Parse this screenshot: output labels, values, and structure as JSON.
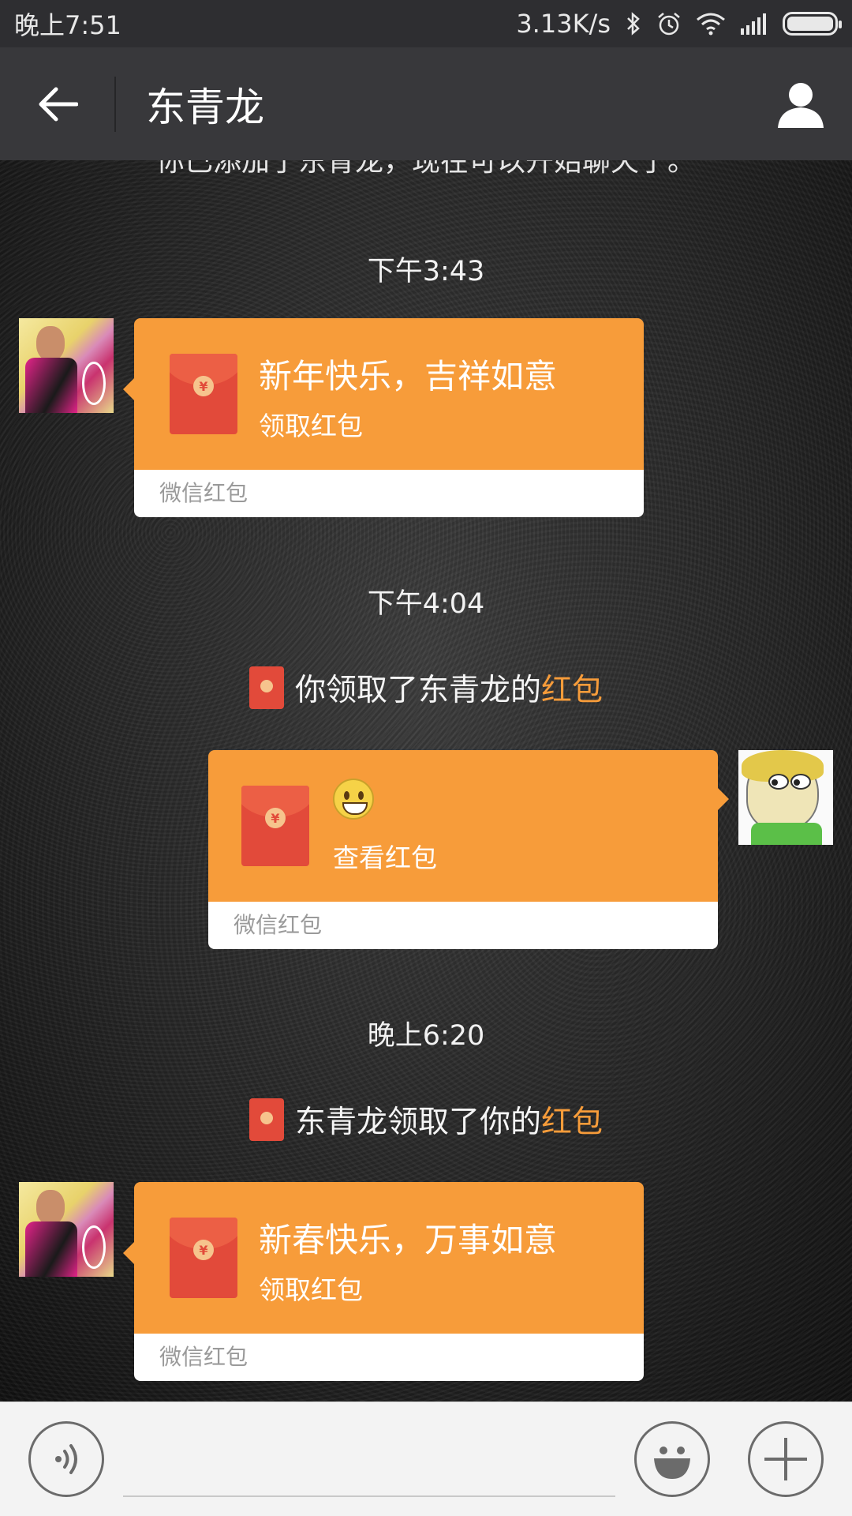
{
  "status_bar": {
    "time": "晚上7:51",
    "network_speed": "3.13K/s",
    "icons": [
      "bluetooth-icon",
      "alarm-icon",
      "wifi-icon",
      "signal-icon",
      "battery-icon"
    ]
  },
  "nav": {
    "title": "东青龙",
    "back_icon": "back-arrow-icon",
    "profile_icon": "profile-icon"
  },
  "chat": {
    "cut_off_text": "你已添加了东青龙，现在可以开始聊天了。",
    "messages": [
      {
        "type": "timestamp",
        "text": "下午3:43"
      },
      {
        "type": "red_packet",
        "side": "left",
        "greeting": "新年快乐，吉祥如意",
        "action": "领取红包",
        "footer": "微信红包"
      },
      {
        "type": "timestamp",
        "text": "下午4:04"
      },
      {
        "type": "notice",
        "text": "你领取了东青龙的",
        "link": "红包"
      },
      {
        "type": "red_packet",
        "side": "right",
        "greeting_icon": "grinning-emoji-icon",
        "action": "查看红包",
        "footer": "微信红包"
      },
      {
        "type": "timestamp",
        "text": "晚上6:20"
      },
      {
        "type": "notice",
        "text": "东青龙领取了你的",
        "link": "红包"
      },
      {
        "type": "red_packet",
        "side": "left",
        "greeting": "新春快乐，万事如意",
        "action": "领取红包",
        "footer": "微信红包"
      }
    ]
  },
  "input_bar": {
    "voice_icon": "voice-icon",
    "emoji_icon": "emoji-icon",
    "add_icon": "plus-icon"
  },
  "colors": {
    "packet_orange": "#f79c3a",
    "envelope_red": "#e24a3a",
    "link_orange": "#f79c3a",
    "nav_bg": "#38383b",
    "status_bg": "#2e2e31"
  }
}
